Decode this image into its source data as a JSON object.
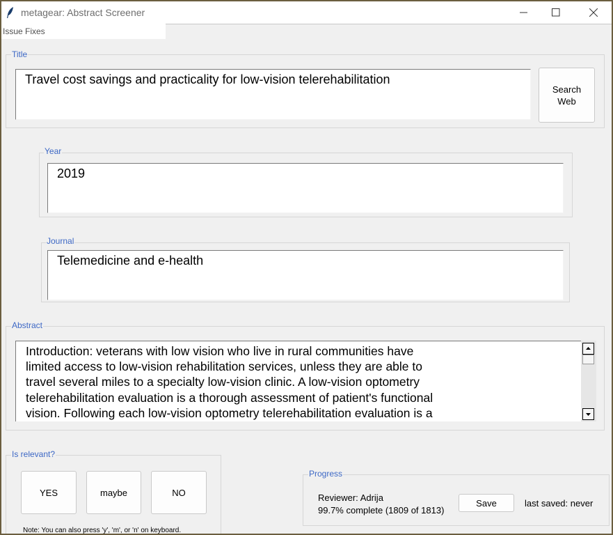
{
  "window": {
    "title": "metagear: Abstract Screener",
    "icons": {
      "app": "feather-icon",
      "minimize": "minimize-icon",
      "maximize": "maximize-icon",
      "close": "close-icon"
    }
  },
  "menu": {
    "items": [
      "Issue Fixes"
    ]
  },
  "title_section": {
    "legend": "Title",
    "value": "Travel cost savings and practicality for low-vision telerehabilitation",
    "search_button": [
      "Search",
      "Web"
    ]
  },
  "year_section": {
    "legend": "Year",
    "value": "2019"
  },
  "journal_section": {
    "legend": "Journal",
    "value": "Telemedicine and e-health"
  },
  "abstract_section": {
    "legend": "Abstract",
    "lines": [
      "Introduction: veterans with low vision who live in rural communities have",
      "limited access to low-vision rehabilitation services, unless they are able to",
      "travel several miles to a specialty low-vision clinic. A low-vision optometry",
      "telerehabilitation evaluation is a thorough assessment of patient's functional",
      "vision. Following each low-vision optometry telerehabilitation evaluation is a"
    ]
  },
  "relevance_section": {
    "legend": "Is relevant?",
    "buttons": {
      "yes": "YES",
      "maybe": "maybe",
      "no": "NO"
    },
    "note": "Note: You can also press 'y', 'm', or 'n' on keyboard."
  },
  "progress_section": {
    "legend": "Progress",
    "reviewer": "Reviewer: Adrija",
    "complete": "99.7% complete (1809 of 1813)",
    "save_button": "Save",
    "last_saved": "last saved: never"
  }
}
